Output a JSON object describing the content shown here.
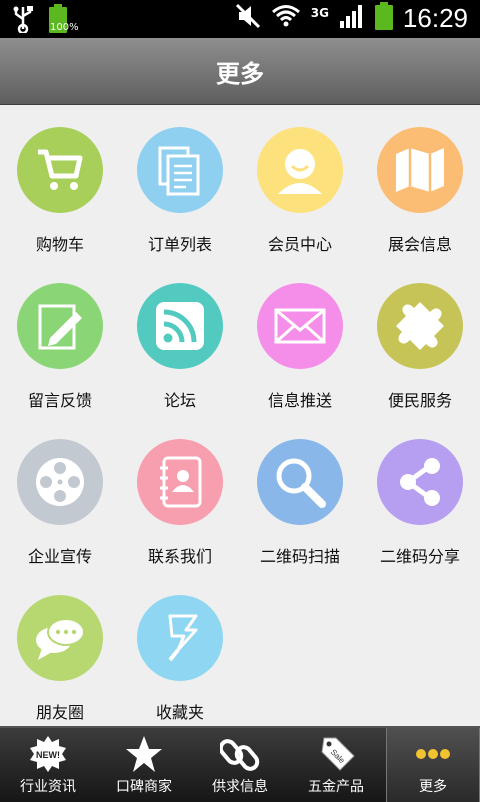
{
  "status_bar": {
    "battery_percent": "100%",
    "network": "3G",
    "time": "16:29"
  },
  "header": {
    "title": "更多"
  },
  "grid": {
    "items": [
      {
        "label": "购物车",
        "icon": "shopping-cart-icon",
        "color": "#a7cf5a"
      },
      {
        "label": "订单列表",
        "icon": "document-list-icon",
        "color": "#8fcfef"
      },
      {
        "label": "会员中心",
        "icon": "user-icon",
        "color": "#fde17d"
      },
      {
        "label": "展会信息",
        "icon": "map-icon",
        "color": "#fbbd73"
      },
      {
        "label": "留言反馈",
        "icon": "edit-pencil-icon",
        "color": "#8ad576"
      },
      {
        "label": "论坛",
        "icon": "rss-icon",
        "color": "#52cabf"
      },
      {
        "label": "信息推送",
        "icon": "envelope-icon",
        "color": "#f58ee9"
      },
      {
        "label": "便民服务",
        "icon": "puzzle-icon",
        "color": "#c6c457"
      },
      {
        "label": "企业宣传",
        "icon": "film-reel-icon",
        "color": "#c3c9d1"
      },
      {
        "label": "联系我们",
        "icon": "contact-book-icon",
        "color": "#f79fae"
      },
      {
        "label": "二维码扫描",
        "icon": "magnifier-icon",
        "color": "#8ab7ea"
      },
      {
        "label": "二维码分享",
        "icon": "share-icon",
        "color": "#b69ef1"
      },
      {
        "label": "朋友圈",
        "icon": "chat-bubbles-icon",
        "color": "#b7d770"
      },
      {
        "label": "收藏夹",
        "icon": "bookmark-icon",
        "color": "#8fd6f2"
      }
    ]
  },
  "tab_bar": {
    "tabs": [
      {
        "label": "行业资讯",
        "icon": "new-badge-icon",
        "badge_text": "NEW!"
      },
      {
        "label": "口碑商家",
        "icon": "star-icon"
      },
      {
        "label": "供求信息",
        "icon": "chain-link-icon"
      },
      {
        "label": "五金产品",
        "icon": "sale-tag-icon",
        "badge_text": "Sale"
      },
      {
        "label": "更多",
        "icon": "more-dots-icon",
        "active": true
      }
    ]
  }
}
